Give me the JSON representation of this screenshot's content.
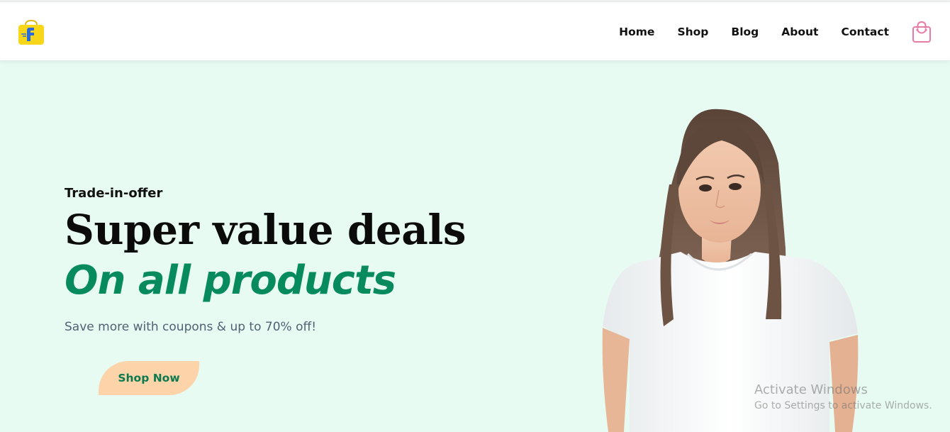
{
  "header": {
    "nav": [
      "Home",
      "Shop",
      "Blog",
      "About",
      "Contact"
    ],
    "logo_icon": "flipkart-shopping-bag-logo",
    "cart_icon": "shopping-bag-icon"
  },
  "hero": {
    "eyebrow": "Trade-in-offer",
    "headline": "Super value deals",
    "subheadline": "On all products",
    "description": "Save more with coupons & up to 70% off!",
    "cta_label": "Shop Now",
    "image": "woman-in-white-tshirt"
  },
  "os_watermark": {
    "title": "Activate Windows",
    "subtitle": "Go to Settings to activate Windows."
  },
  "colors": {
    "hero_bg": "#e8fbf3",
    "accent_green": "#088a5f",
    "button_bg": "#fdd3a9",
    "cart_pink": "#e87aa6",
    "logo_yellow": "#f8d71b",
    "logo_blue": "#2a6ad9"
  }
}
